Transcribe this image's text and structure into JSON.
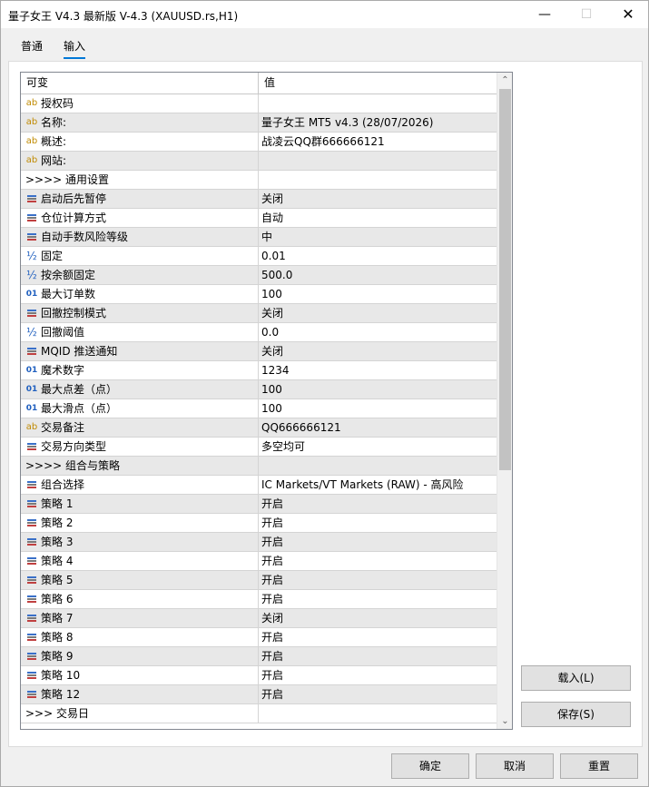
{
  "window": {
    "title": "量子女王 V4.3 最新版 V-4.3 (XAUUSD.rs,H1)",
    "minimize_glyph": "—",
    "maximize_glyph": "☐",
    "close_glyph": "✕"
  },
  "tabs": [
    {
      "label": "普通",
      "selected": false
    },
    {
      "label": "输入",
      "selected": true
    }
  ],
  "grid": {
    "columns": {
      "name": "可变",
      "value": "值"
    },
    "rows": [
      {
        "icon": "ab",
        "name": "授权码",
        "value": ""
      },
      {
        "icon": "ab",
        "name": "名称:",
        "value": "量子女王 MT5 v4.3 (28/07/2026)"
      },
      {
        "icon": "ab",
        "name": "概述:",
        "value": "战凌云QQ群666666121"
      },
      {
        "icon": "ab",
        "name": "网站:",
        "value": ""
      },
      {
        "icon": "",
        "name": ">>>> 通用设置",
        "value": ""
      },
      {
        "icon": "enum",
        "name": "启动后先暂停",
        "value": "关闭"
      },
      {
        "icon": "enum",
        "name": "仓位计算方式",
        "value": "自动"
      },
      {
        "icon": "enum",
        "name": "自动手数风险等级",
        "value": "中"
      },
      {
        "icon": "half",
        "name": "固定",
        "value": "0.01"
      },
      {
        "icon": "half",
        "name": "按余额固定",
        "value": "500.0"
      },
      {
        "icon": "01",
        "name": "最大订单数",
        "value": "100"
      },
      {
        "icon": "enum",
        "name": "回撤控制模式",
        "value": "关闭"
      },
      {
        "icon": "half",
        "name": "回撤阈值",
        "value": "0.0"
      },
      {
        "icon": "enum",
        "name": "MQID 推送通知",
        "value": "关闭"
      },
      {
        "icon": "01",
        "name": "魔术数字",
        "value": "1234"
      },
      {
        "icon": "01",
        "name": "最大点差（点）",
        "value": "100"
      },
      {
        "icon": "01",
        "name": "最大滑点（点）",
        "value": "100"
      },
      {
        "icon": "ab",
        "name": "交易备注",
        "value": "QQ666666121"
      },
      {
        "icon": "enum",
        "name": "交易方向类型",
        "value": "多空均可"
      },
      {
        "icon": "",
        "name": ">>>> 组合与策略",
        "value": ""
      },
      {
        "icon": "enum",
        "name": "组合选择",
        "value": "IC Markets/VT Markets (RAW) - 高风险"
      },
      {
        "icon": "enum",
        "name": "策略 1",
        "value": "开启"
      },
      {
        "icon": "enum",
        "name": "策略 2",
        "value": "开启"
      },
      {
        "icon": "enum",
        "name": "策略 3",
        "value": "开启"
      },
      {
        "icon": "enum",
        "name": "策略 4",
        "value": "开启"
      },
      {
        "icon": "enum",
        "name": "策略 5",
        "value": "开启"
      },
      {
        "icon": "enum",
        "name": "策略 6",
        "value": "开启"
      },
      {
        "icon": "enum",
        "name": "策略 7",
        "value": "关闭"
      },
      {
        "icon": "enum",
        "name": "策略 8",
        "value": "开启"
      },
      {
        "icon": "enum",
        "name": "策略 9",
        "value": "开启"
      },
      {
        "icon": "enum",
        "name": "策略 10",
        "value": "开启"
      },
      {
        "icon": "enum",
        "name": "策略 12",
        "value": "开启"
      },
      {
        "icon": "",
        "name": ">>> 交易日",
        "value": ""
      }
    ]
  },
  "side_buttons": {
    "load": "载入(L)",
    "save": "保存(S)"
  },
  "footer_buttons": {
    "ok": "确定",
    "cancel": "取消",
    "reset": "重置"
  },
  "scrollbar": {
    "up_glyph": "⌃",
    "down_glyph": "⌄"
  }
}
